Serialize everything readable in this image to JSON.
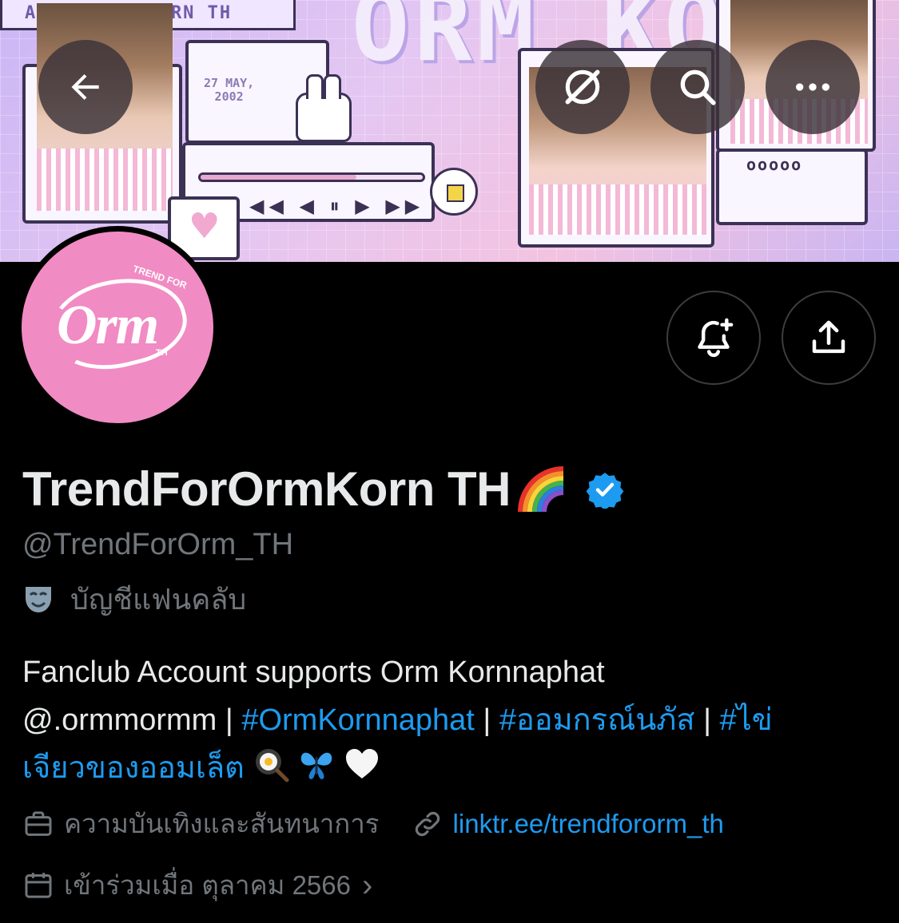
{
  "banner": {
    "strip_text": "AL FOR ORMKORN TH",
    "pixel_title": "ORM KORN",
    "date_line1": "27 MAY,",
    "date_line2": "2002",
    "player_controls": "◀◀ ◀ ⏸ ▶ ▶▶",
    "dots": "ooooo"
  },
  "header": {
    "back_icon": "arrow-left-icon",
    "grok_icon": "grok-slash-icon",
    "search_icon": "search-icon",
    "more_icon": "more-horizontal-icon"
  },
  "avatar": {
    "trend_text": "TREND FOR",
    "brand_text": "Orm",
    "th_text": "TH"
  },
  "actions": {
    "notify_icon": "bell-plus-icon",
    "share_icon": "share-icon"
  },
  "profile": {
    "display_name": "TrendForOrmKorn TH",
    "handle": "@TrendForOrm_TH",
    "account_label": "บัญชีแฟนคลับ",
    "bio_line1": "Fanclub Account supports Orm Kornnaphat",
    "bio_mention": "@.ormmormm",
    "bio_sep": " | ",
    "bio_tag1": "#OrmKornnaphat",
    "bio_tag2": "#ออมกรณ์นภัส",
    "bio_tag3a": "#ไข่",
    "bio_tag3b": "เจียวของออมเล็ต",
    "category": "ความบันเทิงและสันทนาการ",
    "link": "linktr.ee/trendfororm_th",
    "joined": "เข้าร่วมเมื่อ ตุลาคม 2566",
    "chevron": "›"
  },
  "colors": {
    "background": "#000000",
    "text_primary": "#e7e9ea",
    "text_secondary": "#71767b",
    "accent_blue": "#1d9bf0",
    "avatar_pink": "#f18bc3"
  }
}
